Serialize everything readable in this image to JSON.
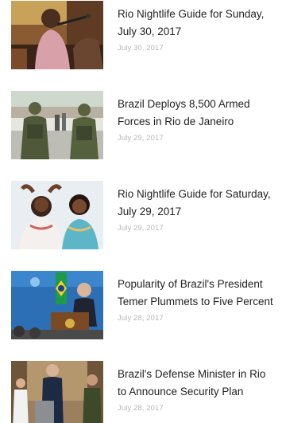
{
  "articles": [
    {
      "title_line1": "Rio Nightlife Guide for Sunday,",
      "title_line2": "July 30, 2017",
      "date": "July 30, 2017",
      "thumbnail": "crowd-singer-photo"
    },
    {
      "title_line1": "Brazil Deploys 8,500 Armed",
      "title_line2": "Forces in Rio de Janeiro",
      "date": "July 29, 2017",
      "thumbnail": "soldiers-photo"
    },
    {
      "title_line1": "Rio Nightlife Guide for Saturday,",
      "title_line2": "July 29, 2017",
      "date": "July 29, 2017",
      "thumbnail": "two-women-photo"
    },
    {
      "title_line1": "Popularity of Brazil's President",
      "title_line2": "Temer Plummets to Five Percent",
      "date": "July 28, 2017",
      "thumbnail": "president-podium-photo"
    },
    {
      "title_line1": "Brazil's Defense Minister in Rio",
      "title_line2": "to Announce Security Plan",
      "date": "July 28, 2017",
      "thumbnail": "defense-minister-photo"
    }
  ]
}
